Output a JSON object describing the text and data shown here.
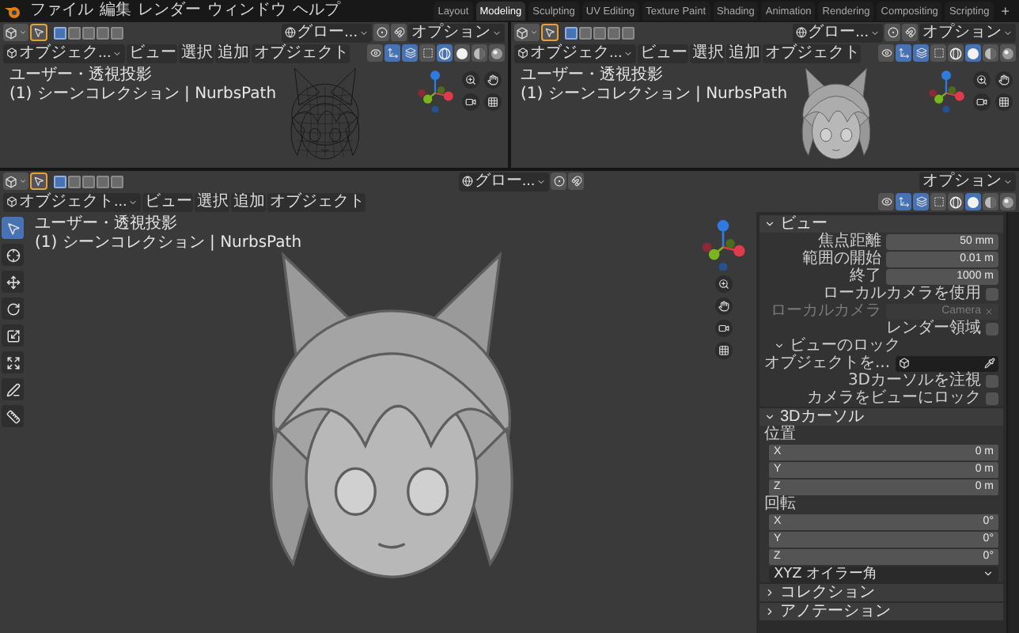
{
  "top_bar": {
    "menus": [
      "ファイル",
      "編集",
      "レンダー",
      "ウィンドウ",
      "ヘルプ"
    ],
    "workspaces": [
      {
        "label": "Layout",
        "selected": false
      },
      {
        "label": "Modeling",
        "selected": true
      },
      {
        "label": "Sculpting",
        "selected": false
      },
      {
        "label": "UV Editing",
        "selected": false
      },
      {
        "label": "Texture Paint",
        "selected": false
      },
      {
        "label": "Shading",
        "selected": false
      },
      {
        "label": "Animation",
        "selected": false
      },
      {
        "label": "Rendering",
        "selected": false
      },
      {
        "label": "Compositing",
        "selected": false
      },
      {
        "label": "Scripting",
        "selected": false
      }
    ],
    "add_tab": "+"
  },
  "viewports": [
    {
      "transform_orientation": "グロー...",
      "options": "オプション",
      "select_modes": [
        {
          "selected": true
        },
        {
          "selected": false
        },
        {
          "selected": false
        },
        {
          "selected": false
        },
        {
          "selected": false
        }
      ],
      "mode": "オブジェク...",
      "menus": [
        "ビュー",
        "選択",
        "追加",
        "オブジェクト"
      ],
      "shading": [
        {
          "kind": "wireframe",
          "selected": true
        },
        {
          "kind": "solid",
          "selected": false
        },
        {
          "kind": "material",
          "selected": false
        },
        {
          "kind": "rendered",
          "selected": false
        }
      ],
      "view_name": "ユーザー・透視投影",
      "collection": "(1) シーンコレクション | NurbsPath"
    },
    {
      "transform_orientation": "グロー...",
      "options": "オプション",
      "select_modes": [
        {
          "selected": true
        },
        {
          "selected": false
        },
        {
          "selected": false
        },
        {
          "selected": false
        },
        {
          "selected": false
        }
      ],
      "mode": "オブジェク...",
      "menus": [
        "ビュー",
        "選択",
        "追加",
        "オブジェクト"
      ],
      "shading": [
        {
          "kind": "wireframe",
          "selected": false
        },
        {
          "kind": "solid",
          "selected": true
        },
        {
          "kind": "material",
          "selected": false
        },
        {
          "kind": "rendered",
          "selected": false
        }
      ],
      "view_name": "ユーザー・透視投影",
      "collection": "(1) シーンコレクション | NurbsPath"
    },
    {
      "transform_orientation": "グロー...",
      "options": "オプション",
      "select_modes": [
        {
          "selected": true
        },
        {
          "selected": false
        },
        {
          "selected": false
        },
        {
          "selected": false
        },
        {
          "selected": false
        }
      ],
      "mode": "オブジェクト...",
      "menus": [
        "ビュー",
        "選択",
        "追加",
        "オブジェクト"
      ],
      "shading": [
        {
          "kind": "wireframe",
          "selected": false
        },
        {
          "kind": "solid",
          "selected": true
        },
        {
          "kind": "material",
          "selected": false
        },
        {
          "kind": "rendered",
          "selected": false
        }
      ],
      "view_name": "ユーザー・透視投影",
      "collection": "(1) シーンコレクション | NurbsPath",
      "tools": [
        {
          "kind": "select",
          "selected": true
        },
        {
          "kind": "cursor",
          "selected": false
        },
        {
          "kind": "move",
          "selected": false
        },
        {
          "kind": "rotate",
          "selected": false
        },
        {
          "kind": "scale",
          "selected": false
        },
        {
          "kind": "transform",
          "selected": false
        },
        {
          "kind": "annotate",
          "selected": false
        },
        {
          "kind": "measure",
          "selected": false
        }
      ],
      "sidebar": [
        {
          "title": "ビュー",
          "expanded": true,
          "rows": [
            {
              "kind": "field",
              "label": "焦点距離",
              "value": "50 mm"
            },
            {
              "kind": "field",
              "label": "範囲の開始",
              "value": "0.01 m"
            },
            {
              "kind": "field",
              "label": "終了",
              "value": "1000 m"
            },
            {
              "kind": "checkbox",
              "label": "ローカルカメラを使用",
              "checked": false
            },
            {
              "kind": "camera",
              "label": "ローカルカメラ",
              "value": "Camera",
              "disabled": true
            },
            {
              "kind": "checkbox",
              "label": "レンダー領域",
              "checked": false
            },
            {
              "kind": "subheader",
              "label": "ビューのロック",
              "expanded": true
            },
            {
              "kind": "object",
              "label": "オブジェクトを..."
            },
            {
              "kind": "checkbox",
              "label": "3Dカーソルを注視",
              "checked": false
            },
            {
              "kind": "checkbox",
              "label": "カメラをビューにロック",
              "checked": false
            }
          ]
        },
        {
          "title": "3Dカーソル",
          "expanded": true,
          "rows": [
            {
              "kind": "label",
              "label": "位置"
            },
            {
              "kind": "axis",
              "label": "X",
              "value": "0 m"
            },
            {
              "kind": "axis",
              "label": "Y",
              "value": "0 m"
            },
            {
              "kind": "axis",
              "label": "Z",
              "value": "0 m"
            },
            {
              "kind": "label",
              "label": "回転"
            },
            {
              "kind": "axis",
              "label": "X",
              "value": "0°"
            },
            {
              "kind": "axis",
              "label": "Y",
              "value": "0°"
            },
            {
              "kind": "axis",
              "label": "Z",
              "value": "0°"
            },
            {
              "kind": "dropdown",
              "value": "XYZ オイラー角"
            }
          ]
        },
        {
          "title": "コレクション",
          "expanded": false
        },
        {
          "title": "アノテーション",
          "expanded": false
        }
      ]
    }
  ]
}
